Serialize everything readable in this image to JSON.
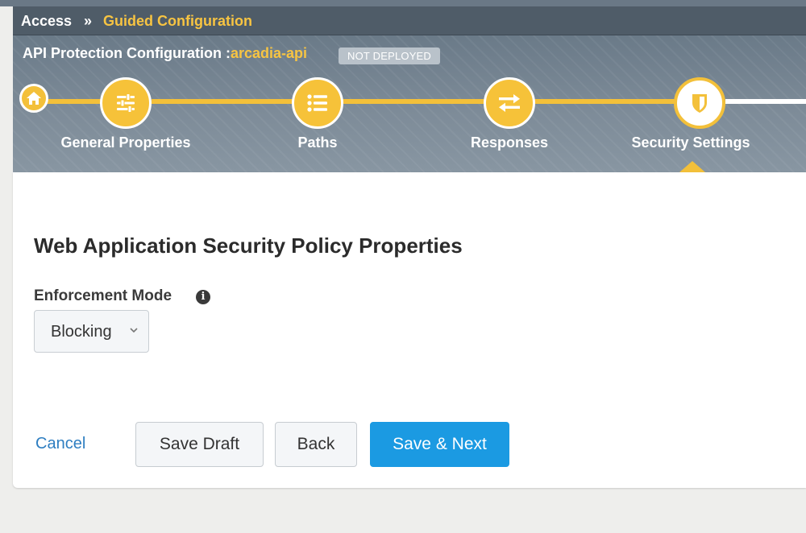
{
  "breadcrumb": {
    "root": "Access",
    "separator": "»",
    "current": "Guided Configuration"
  },
  "config": {
    "title_prefix": "API Protection Configuration :",
    "name": "arcadia-api",
    "status_badge": "NOT DEPLOYED"
  },
  "wizard": {
    "home_icon": "home-icon",
    "steps": [
      {
        "label": "General Properties",
        "icon": "sliders-icon",
        "state": "complete"
      },
      {
        "label": "Paths",
        "icon": "list-icon",
        "state": "complete"
      },
      {
        "label": "Responses",
        "icon": "arrows-exchange-icon",
        "state": "complete"
      },
      {
        "label": "Security Settings",
        "icon": "shield-icon",
        "state": "active"
      }
    ]
  },
  "main": {
    "section_title": "Web Application Security Policy Properties",
    "enforcement": {
      "label": "Enforcement Mode",
      "info_icon": "info-icon",
      "info_glyph": "i",
      "selected": "Blocking"
    }
  },
  "actions": {
    "cancel": "Cancel",
    "save_draft": "Save Draft",
    "back": "Back",
    "save_next": "Save & Next"
  },
  "colors": {
    "accent_yellow": "#f3c03a",
    "primary_blue": "#1b9ae2",
    "link_blue": "#2e7ec1",
    "header_slate": "#6a7a88"
  }
}
